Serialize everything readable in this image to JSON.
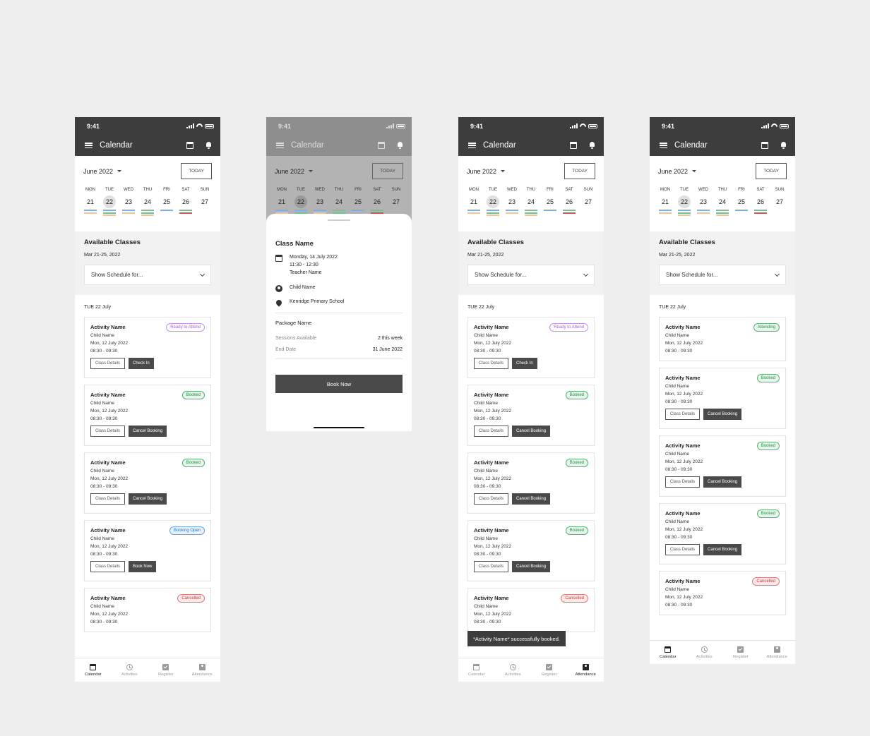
{
  "colors": {
    "appbar": "#3d3d3d",
    "blue_mark": "#7db0ea",
    "green_mark": "#79c08e",
    "orange_mark": "#f2c49b",
    "red_mark": "#c45a5a"
  },
  "status": {
    "time": "9:41"
  },
  "appbar": {
    "title": "Calendar",
    "icons": [
      "menu-icon",
      "calendar-icon",
      "bell-icon"
    ]
  },
  "week": {
    "month": "June 2022",
    "today_label": "TODAY",
    "days": [
      {
        "name": "MON",
        "num": "21",
        "marks": [
          "blue",
          "orange"
        ]
      },
      {
        "name": "TUE",
        "num": "22",
        "marks": [
          "blue",
          "green",
          "orange"
        ],
        "selected": true
      },
      {
        "name": "WED",
        "num": "23",
        "marks": [
          "blue",
          "orange"
        ]
      },
      {
        "name": "THU",
        "num": "24",
        "marks": [
          "green",
          "green",
          "orange"
        ]
      },
      {
        "name": "FRI",
        "num": "25",
        "marks": [
          "blue"
        ]
      },
      {
        "name": "SAT",
        "num": "26",
        "marks": [
          "green",
          "red"
        ]
      },
      {
        "name": "SUN",
        "num": "27",
        "marks": []
      }
    ]
  },
  "available": {
    "title": "Available Classes",
    "date_range": "Mar 21-25, 2022",
    "schedule_placeholder": "Show Schedule for..."
  },
  "list_date": "TUE 22 July",
  "card": {
    "activity": "Activity Name",
    "child": "Child Name",
    "date": "Mon, 12 July 2022",
    "time": "08:30 - 09:30",
    "details_btn": "Class Details"
  },
  "screen1_cards": [
    {
      "badge": "Ready to Attend",
      "badge_type": "ready",
      "action": "Check In"
    },
    {
      "badge": "Booked",
      "badge_type": "booked",
      "action": "Cancel Booking"
    },
    {
      "badge": "Booked",
      "badge_type": "booked",
      "action": "Cancel Booking"
    },
    {
      "badge": "Booking Open",
      "badge_type": "open",
      "action": "Book Now"
    },
    {
      "badge": "Cancelled",
      "badge_type": "cancel",
      "action": ""
    }
  ],
  "screen3_cards": [
    {
      "badge": "Ready to Attend",
      "badge_type": "ready",
      "action": "Check In"
    },
    {
      "badge": "Booked",
      "badge_type": "booked",
      "action": "Cancel Booking"
    },
    {
      "badge": "Booked",
      "badge_type": "booked",
      "action": "Cancel Booking"
    },
    {
      "badge": "Booked",
      "badge_type": "booked",
      "action": "Cancel Booking"
    },
    {
      "badge": "Cancelled",
      "badge_type": "cancel",
      "action": ""
    }
  ],
  "screen4_cards": [
    {
      "badge": "Attending",
      "badge_type": "attend",
      "action": ""
    },
    {
      "badge": "Booked",
      "badge_type": "booked",
      "action": "Cancel Booking"
    },
    {
      "badge": "Booked",
      "badge_type": "booked",
      "action": "Cancel Booking"
    },
    {
      "badge": "Booked",
      "badge_type": "booked",
      "action": "Cancel Booking"
    },
    {
      "badge": "Cancelled",
      "badge_type": "cancel",
      "action": ""
    }
  ],
  "toast": "*Activity Name* successfully booked.",
  "nav": {
    "items": [
      {
        "label": "Calendar",
        "icon": "calendar-icon"
      },
      {
        "label": "Activities",
        "icon": "alarm-icon"
      },
      {
        "label": "Register",
        "icon": "register-icon"
      },
      {
        "label": "Attendance",
        "icon": "attendance-icon"
      }
    ]
  },
  "sheet": {
    "class_name": "Class Name",
    "date": "Monday, 14 July 2022",
    "time": "11:30 - 12:30",
    "teacher": "Teacher Name",
    "child": "Child Name",
    "location": "Kenridge Primary School",
    "package_name": "Package Name",
    "sessions_label": "Sessions Available",
    "sessions_value": "2 this week",
    "end_label": "End Date",
    "end_value": "31 June 2022",
    "book_btn": "Book Now"
  }
}
